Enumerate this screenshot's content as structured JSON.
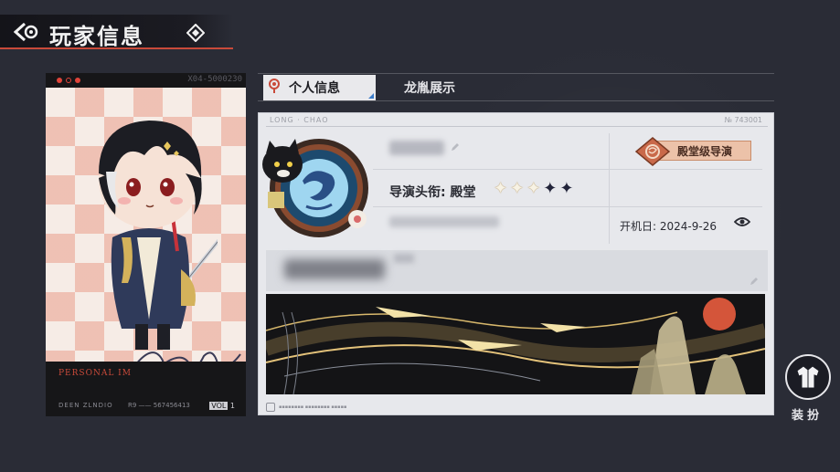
{
  "header": {
    "title": "玩家信息"
  },
  "card": {
    "code": "X04-5000230",
    "bottom_title": "PERSONAL IM",
    "studio": "DEEN ZLNDIO",
    "number": "R9 —— 567456413",
    "vol_label": "VOL",
    "vol_num": "1"
  },
  "tabs": [
    {
      "label": "个人信息",
      "active": true
    },
    {
      "label": "龙胤展示",
      "active": false
    }
  ],
  "panel": {
    "header_left": "LONG · CHAO",
    "header_right": "№ 743001",
    "title_label": "导演头衔: 殿堂",
    "stars_filled": 3,
    "stars_total": 5,
    "badge_text": "殿堂级导演",
    "boot_date_label": "开机日: 2024-9-26"
  },
  "dress": {
    "label": "装扮"
  },
  "colors": {
    "accent": "#c94a3a",
    "badge_bg": "#ecc2a9",
    "panel_bg": "#e7e8ec"
  }
}
